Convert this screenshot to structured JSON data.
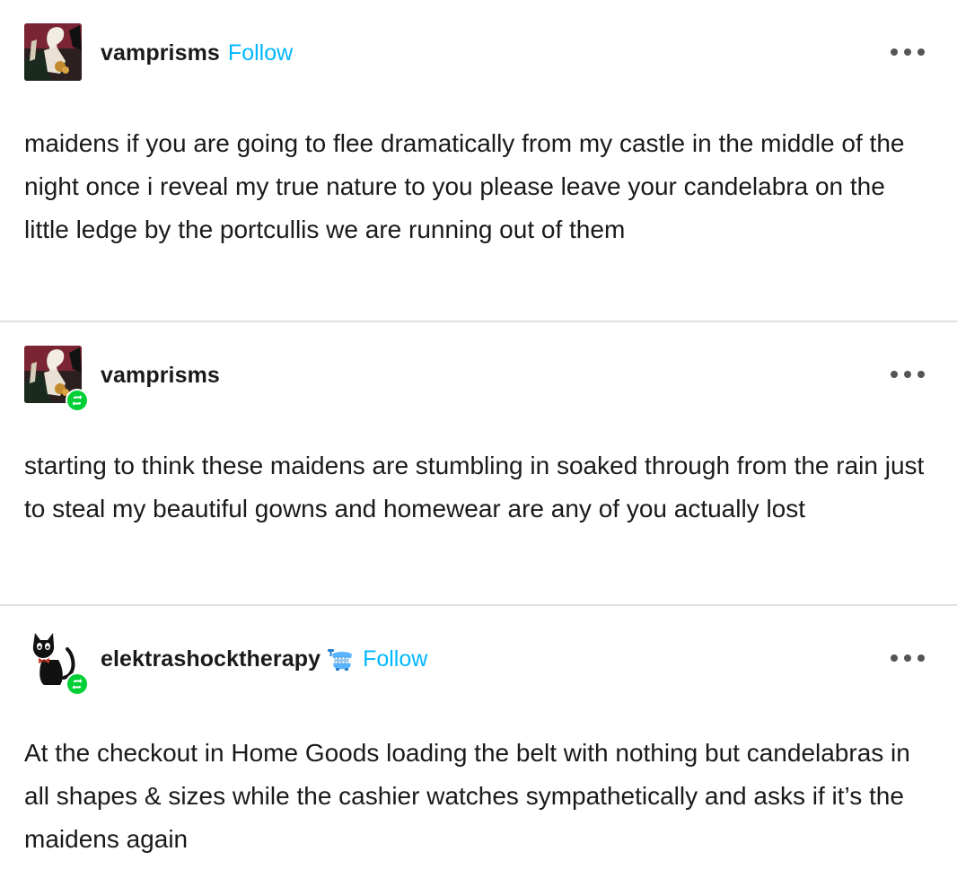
{
  "colors": {
    "follow_link": "#00b8ff",
    "reblog_badge": "#00cf35",
    "divider": "#e0e0e0",
    "text": "#1a1a1a"
  },
  "posts": [
    {
      "username": "vamprisms",
      "follow_label": "Follow",
      "avatar": "gothic-illustration-avatar",
      "reblog_badge_icon": null,
      "more_icon": "more-options-icon",
      "body": "maidens if you are going to flee dramatically from my castle in the middle of the night once i reveal my true nature to you please leave your candelabra on the little ledge by the portcullis we are running out of them"
    },
    {
      "username": "vamprisms",
      "follow_label": null,
      "avatar": "gothic-illustration-avatar",
      "reblog_badge_icon": "reblog-icon",
      "more_icon": "more-options-icon",
      "body": "starting to think these maidens are stumbling in soaked through from the rain just to steal my beautiful gowns and homewear are any of you actually lost"
    },
    {
      "username": "elektrashocktherapy",
      "follow_label": "Follow",
      "avatar": "black-cat-avatar",
      "reblog_badge_icon": "reblog-icon",
      "user_badge_icon": "wind-up-teeth-badge-icon",
      "more_icon": "more-options-icon",
      "body": "At the checkout in Home Goods loading the belt with nothing but candelabras in all shapes & sizes while the cashier watches sympathetically and asks if it’s the maidens again"
    }
  ]
}
